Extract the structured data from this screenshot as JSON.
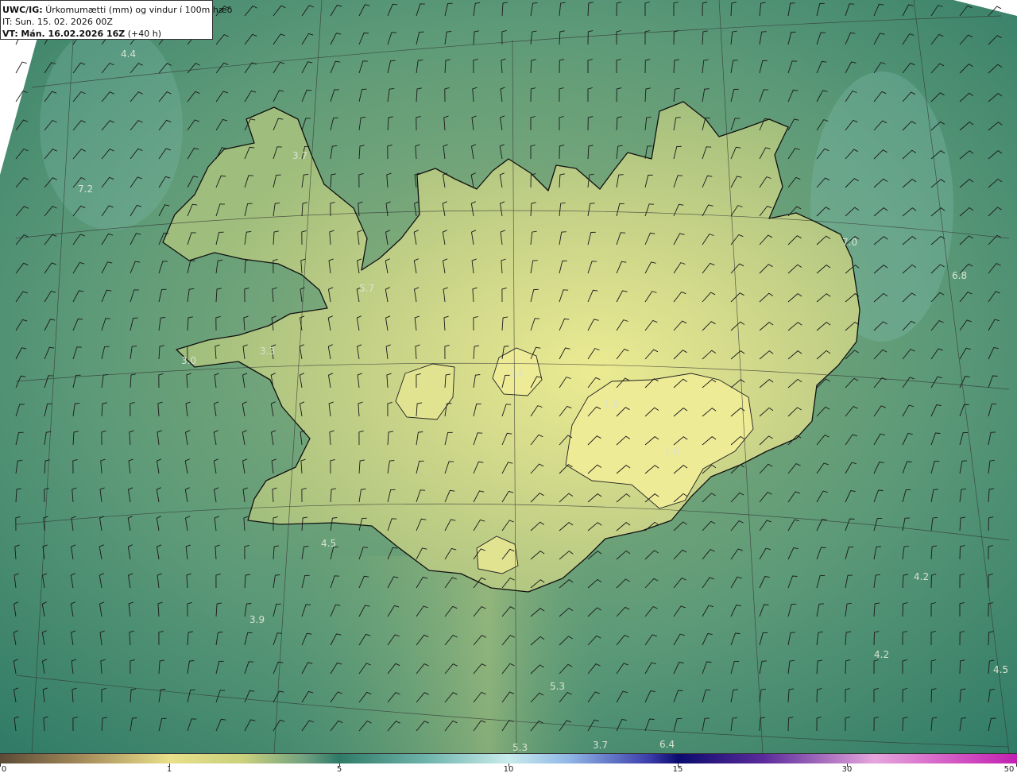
{
  "header": {
    "model": "UWC/IG:",
    "title": "Úrkomumætti (mm) og vindur í 100m hæð",
    "issue_time": "IT: Sun. 15. 02. 2026 00Z",
    "valid_prefix": "VT:",
    "valid_time": "Mán. 16.02.2026 16Z",
    "lead": "(+40 h)"
  },
  "colors": {
    "sea_dark": "#2f7a66",
    "sea_light": "#5fa894",
    "land_low": "#8fb27a",
    "land_high": "#e6e78e",
    "coast": "#111111"
  },
  "map_labels": [
    {
      "text": "4.4"
    },
    {
      "text": "7.2"
    },
    {
      "text": "3.7"
    },
    {
      "text": "5.7"
    },
    {
      "text": "3.3"
    },
    {
      "text": "3.0"
    },
    {
      "text": "1.4"
    },
    {
      "text": "1.0"
    },
    {
      "text": "1.0"
    },
    {
      "text": "7.0"
    },
    {
      "text": "6.8"
    },
    {
      "text": "4.5"
    },
    {
      "text": "3.9"
    },
    {
      "text": "4.2"
    },
    {
      "text": "4.2"
    },
    {
      "text": "4.5"
    },
    {
      "text": "5.3"
    },
    {
      "text": "5.3"
    },
    {
      "text": "3.7"
    },
    {
      "text": "6.4"
    }
  ],
  "colorbar": {
    "ticks": [
      "0",
      "1",
      "5",
      "10",
      "15",
      "30",
      "50"
    ]
  }
}
